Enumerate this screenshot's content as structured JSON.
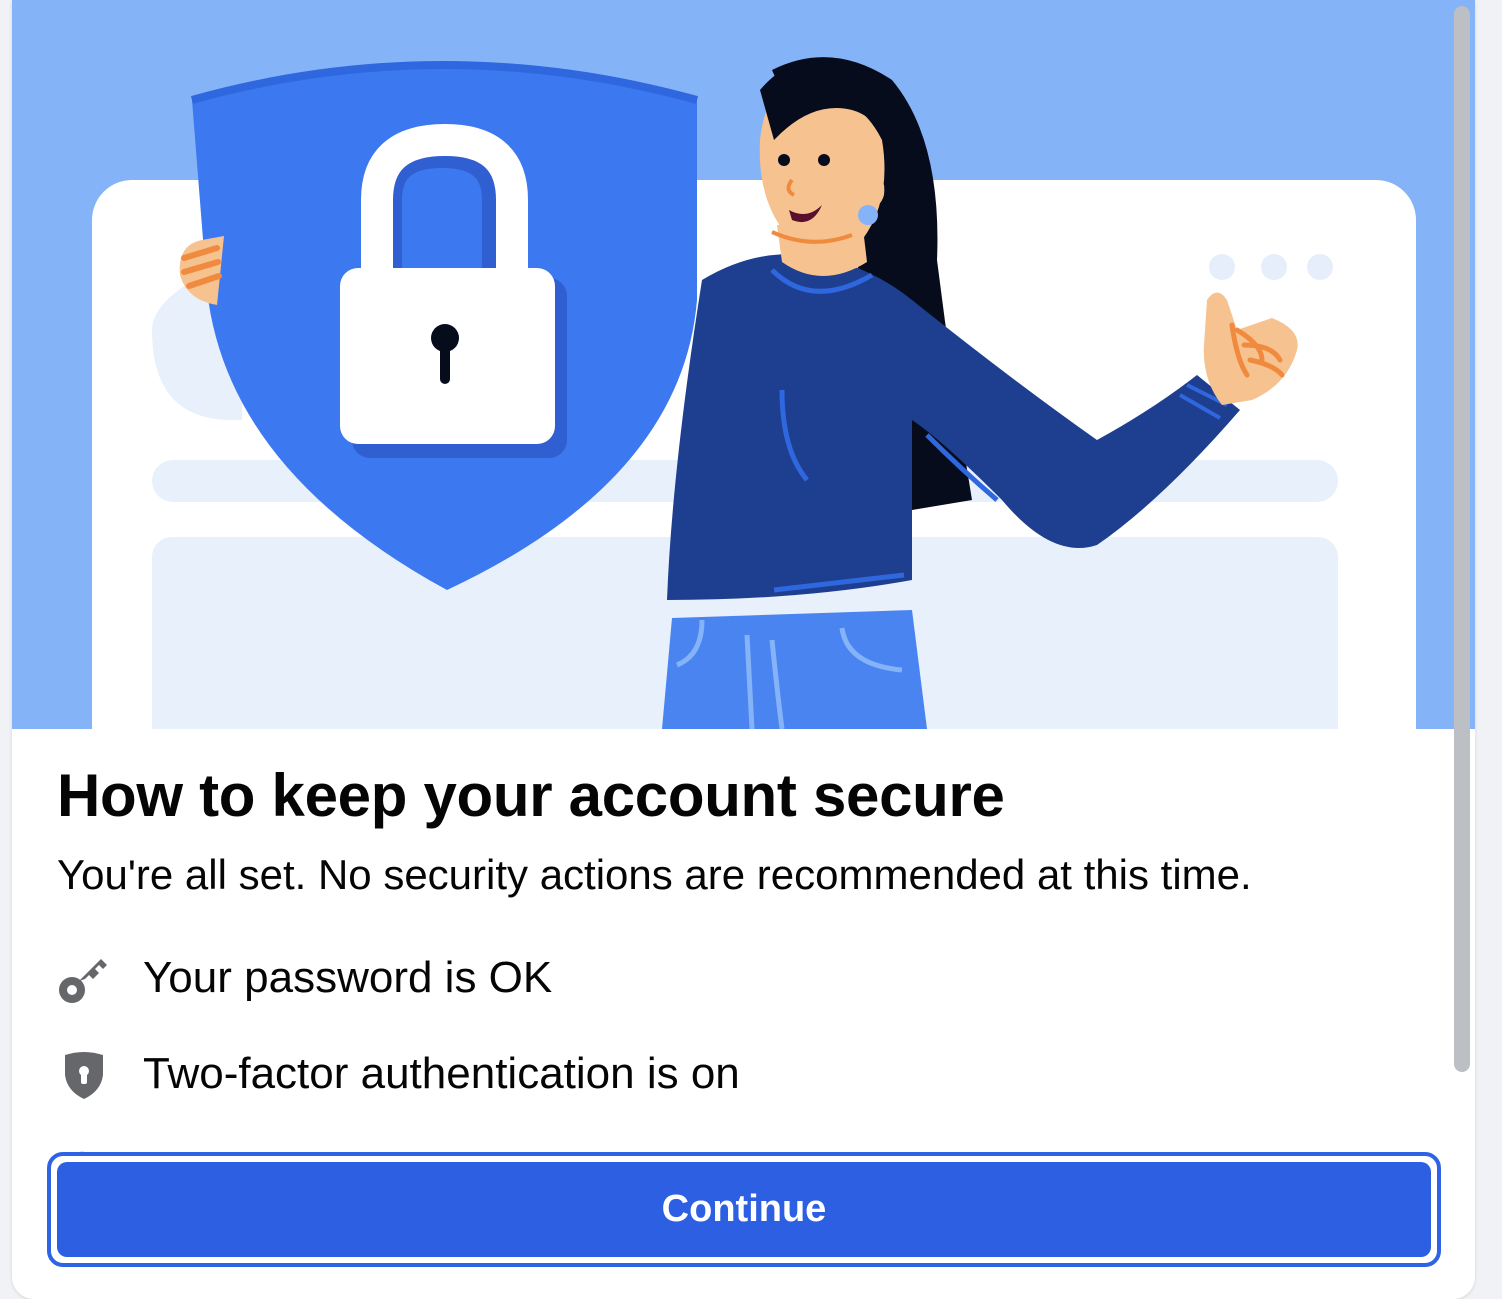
{
  "modal": {
    "title": "How to keep your account secure",
    "subtitle": "You're all set. No security actions are recommended at this time."
  },
  "status_items": [
    {
      "icon": "key-icon",
      "label": "Your password is OK"
    },
    {
      "icon": "shield-lock-icon",
      "label": "Two-factor authentication is on"
    }
  ],
  "continue_label": "Continue",
  "colors": {
    "primary": "#2d5fe3",
    "hero_background": "#85b3f7",
    "shield": "#3c78f0",
    "sweater": "#1e3f8f",
    "text": "#050505",
    "icon_gray": "#65676b"
  },
  "illustration": "woman-holding-security-shield-illustration"
}
